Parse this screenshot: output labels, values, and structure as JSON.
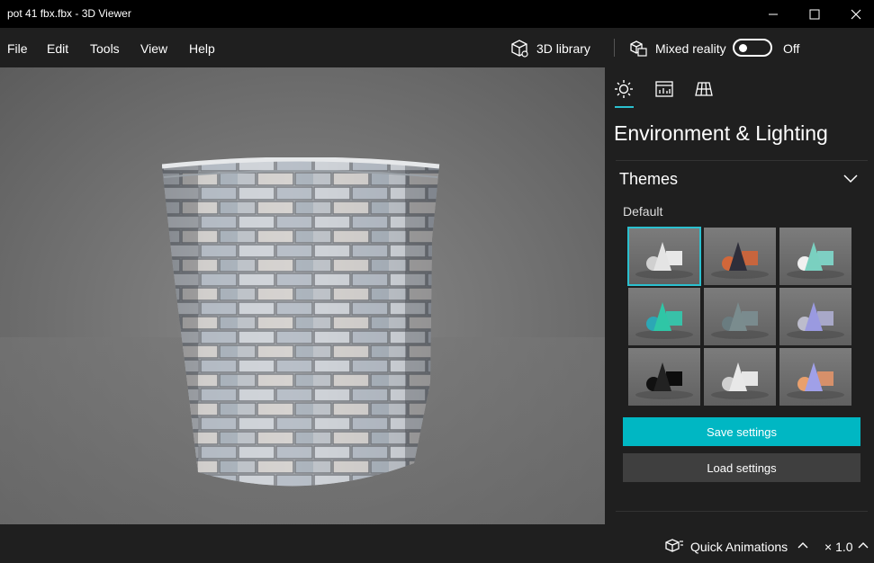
{
  "window": {
    "title": "pot 41 fbx.fbx - 3D Viewer"
  },
  "menu": {
    "file": "File",
    "edit": "Edit",
    "tools": "Tools",
    "view": "View",
    "help": "Help",
    "library": "3D library",
    "mixed_reality": "Mixed reality",
    "mixed_reality_state": "Off"
  },
  "panel": {
    "tabs": [
      {
        "icon": "sun-icon",
        "active": true
      },
      {
        "icon": "stats-icon",
        "active": false
      },
      {
        "icon": "grid-icon",
        "active": false
      }
    ],
    "title": "Environment & Lighting",
    "themes_header": "Themes",
    "theme_name": "Default",
    "themes": [
      {
        "name": "default-light",
        "cone": "#e4e4e4",
        "ball": "#d0d0d0",
        "box": "#e8e8e8",
        "selected": true
      },
      {
        "name": "dark-orange",
        "cone": "#2e2e3a",
        "ball": "#d2673a",
        "box": "#c8653d",
        "selected": false
      },
      {
        "name": "teal-white",
        "cone": "#7ad0c0",
        "ball": "#f0f0f0",
        "box": "#7ecfc3",
        "selected": false
      },
      {
        "name": "teal",
        "cone": "#2fc6a6",
        "ball": "#2ca7b5",
        "box": "#38c1a8",
        "selected": false
      },
      {
        "name": "slate",
        "cone": "#7a8c8e",
        "ball": "#6a7c80",
        "box": "#7a8b8e",
        "selected": false
      },
      {
        "name": "violet",
        "cone": "#9a9ae0",
        "ball": "#bcbccc",
        "box": "#a8a8c8",
        "selected": false
      },
      {
        "name": "black",
        "cone": "#222222",
        "ball": "#111111",
        "box": "#0c0c0c",
        "selected": false
      },
      {
        "name": "white",
        "cone": "#e8e8e8",
        "ball": "#cfcfcf",
        "box": "#e6e6e6",
        "selected": false
      },
      {
        "name": "sunset",
        "cone": "#a0a0e8",
        "ball": "#e9a06d",
        "box": "#d6906a",
        "selected": false
      }
    ],
    "save_label": "Save settings",
    "load_label": "Load settings"
  },
  "statusbar": {
    "quick_animations": "Quick Animations",
    "speed": "× 1.0"
  },
  "colors": {
    "accent": "#00b7c3",
    "background": "#1f1f1f",
    "titlebar": "#000000"
  }
}
